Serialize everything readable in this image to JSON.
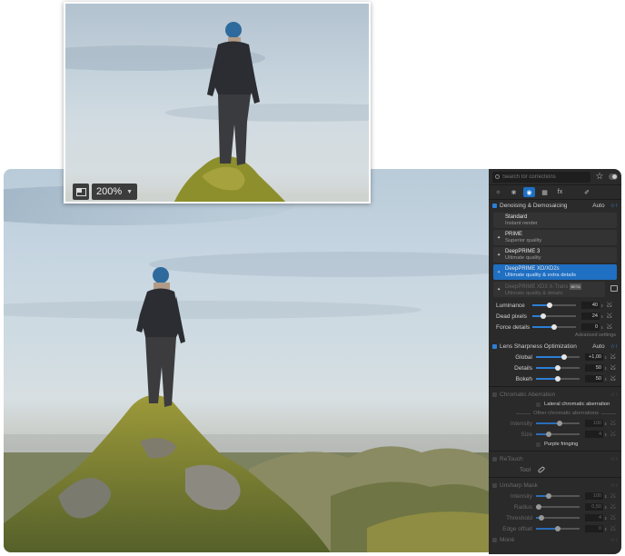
{
  "zoom_preview": {
    "zoom_level": "200%"
  },
  "panel": {
    "search_placeholder": "Search for corrections",
    "tabs": [
      {
        "name": "light-tab-icon",
        "glyph": "☼"
      },
      {
        "name": "color-tab-icon",
        "glyph": "❀"
      },
      {
        "name": "detail-tab-icon",
        "glyph": "◉"
      },
      {
        "name": "geometry-tab-icon",
        "glyph": "▦"
      },
      {
        "name": "fx-tab-icon",
        "glyph": "fx"
      },
      {
        "name": "local-adjust-tab-icon",
        "glyph": "✐"
      }
    ],
    "denoising": {
      "title": "Denoising & Demosaicing",
      "mode": "Auto",
      "options": [
        {
          "title": "Standard",
          "subtitle": "Instant render"
        },
        {
          "title": "PRIME",
          "subtitle": "Superior quality"
        },
        {
          "title": "DeepPRIME 3",
          "subtitle": "Ultimate quality"
        },
        {
          "title": "DeepPRIME XD/XD2s",
          "subtitle": "Ultimate quality & extra details"
        },
        {
          "title": "DeepPRIME XD3 X-Trans",
          "badge": "BETA",
          "subtitle": "Ultimate quality & details"
        }
      ],
      "sliders": [
        {
          "label": "Luminance",
          "value": "40",
          "level": 0.4
        },
        {
          "label": "Dead pixels",
          "value": "24",
          "level": 0.24
        },
        {
          "label": "Force details",
          "value": "0",
          "level": 0.5
        }
      ],
      "advanced_label": "Advanced settings"
    },
    "lens_sharpness": {
      "title": "Lens Sharpness Optimization",
      "mode": "Auto",
      "sliders": [
        {
          "label": "Global",
          "value": "+1,00",
          "level": 0.65
        },
        {
          "label": "Details",
          "value": "50",
          "level": 0.5
        },
        {
          "label": "Bokeh",
          "value": "50",
          "level": 0.5
        }
      ]
    },
    "chromatic_aberration": {
      "title": "Chromatic Aberration",
      "lateral_label": "Lateral chromatic aberration",
      "other_label": "Other chromatic aberrations",
      "sliders": [
        {
          "label": "Intensity",
          "value": "100",
          "level": 0.55
        },
        {
          "label": "Size",
          "value": "4",
          "level": 0.3
        }
      ],
      "purple_label": "Purple fringing"
    },
    "retouch": {
      "title": "ReTouch",
      "tool_label": "Tool"
    },
    "unsharp_mask": {
      "title": "Unsharp Mask",
      "sliders": [
        {
          "label": "Intensity",
          "value": "100",
          "level": 0.3
        },
        {
          "label": "Radius",
          "value": "0,50",
          "level": 0.06
        },
        {
          "label": "Threshold",
          "value": "4",
          "level": 0.12
        },
        {
          "label": "Edge offset",
          "value": "0",
          "level": 0.5
        }
      ]
    },
    "moire": {
      "title": "Moiré"
    }
  }
}
